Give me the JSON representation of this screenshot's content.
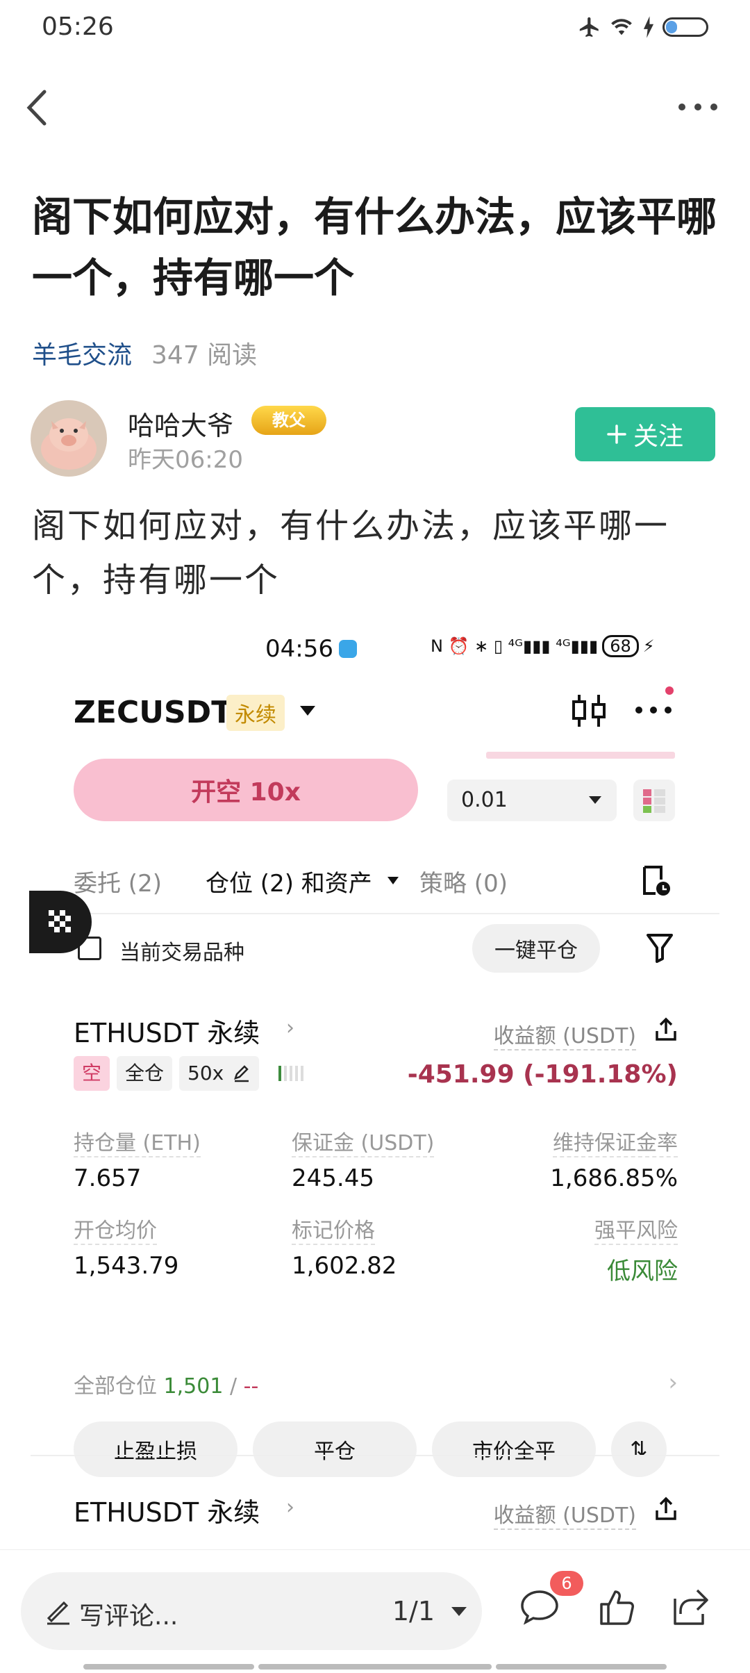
{
  "status_bar": {
    "time": "05:26"
  },
  "nav": {},
  "article": {
    "title": "阁下如何应对，有什么办法，应该平哪一个，持有哪一个",
    "category": "羊毛交流",
    "reads": "347 阅读",
    "author_name": "哈哈大爷",
    "author_badge": "教父",
    "post_time": "昨天06:20",
    "follow_label": "关注",
    "body": "阁下如何应对，有什么办法，应该平哪一个，持有哪一个"
  },
  "screenshot": {
    "status_time": "04:56",
    "battery": "68",
    "pair": "ZECUSDT",
    "perp_tag": "永续",
    "short_button": "开空 10x",
    "quantity": "0.01",
    "tabs": [
      "委托 (2)",
      "仓位 (2) 和资产",
      "策略 (0)"
    ],
    "current_symbol_label": "当前交易品种",
    "close_all_label": "一键平仓",
    "positions": [
      {
        "symbol": "ETHUSDT 永续",
        "pnl_label": "收益额 (USDT)",
        "side": "空",
        "margin_mode": "全仓",
        "leverage": "50x",
        "pnl": "-451.99 (-191.18%)",
        "size_label": "持仓量 (ETH)",
        "size": "7.657",
        "margin_label": "保证金 (USDT)",
        "margin": "245.45",
        "mmr_label": "维持保证金率",
        "mmr": "1,686.85%",
        "entry_label": "开仓均价",
        "entry": "1,543.79",
        "mark_label": "标记价格",
        "mark": "1,602.82",
        "risk_label": "强平风险",
        "risk": "低风险",
        "all_pos_label": "全部仓位",
        "all_pos_value": "1,501",
        "all_pos_sep": " / ",
        "all_pos_other": "--",
        "actions": [
          "止盈止损",
          "平仓",
          "市价全平",
          "⇅"
        ]
      },
      {
        "symbol": "ETHUSDT 永续",
        "pnl_label": "收益额 (USDT)"
      }
    ]
  },
  "bottom": {
    "comment_placeholder": "写评论...",
    "page": "1/1",
    "comment_count": "6"
  },
  "colors": {
    "accent_green": "#2fbf96",
    "short_pink": "#f9bfd0",
    "loss_red": "#a8334f",
    "profit_green": "#3a8a37"
  },
  "icons": [
    "back-icon",
    "more-icon",
    "airplane-icon",
    "wifi-icon",
    "charge-icon",
    "battery-icon",
    "plus-icon",
    "candlestick-icon",
    "order-history-icon",
    "filter-icon",
    "share-icon",
    "edit-icon",
    "comment-icon",
    "like-icon",
    "share-out-icon"
  ]
}
